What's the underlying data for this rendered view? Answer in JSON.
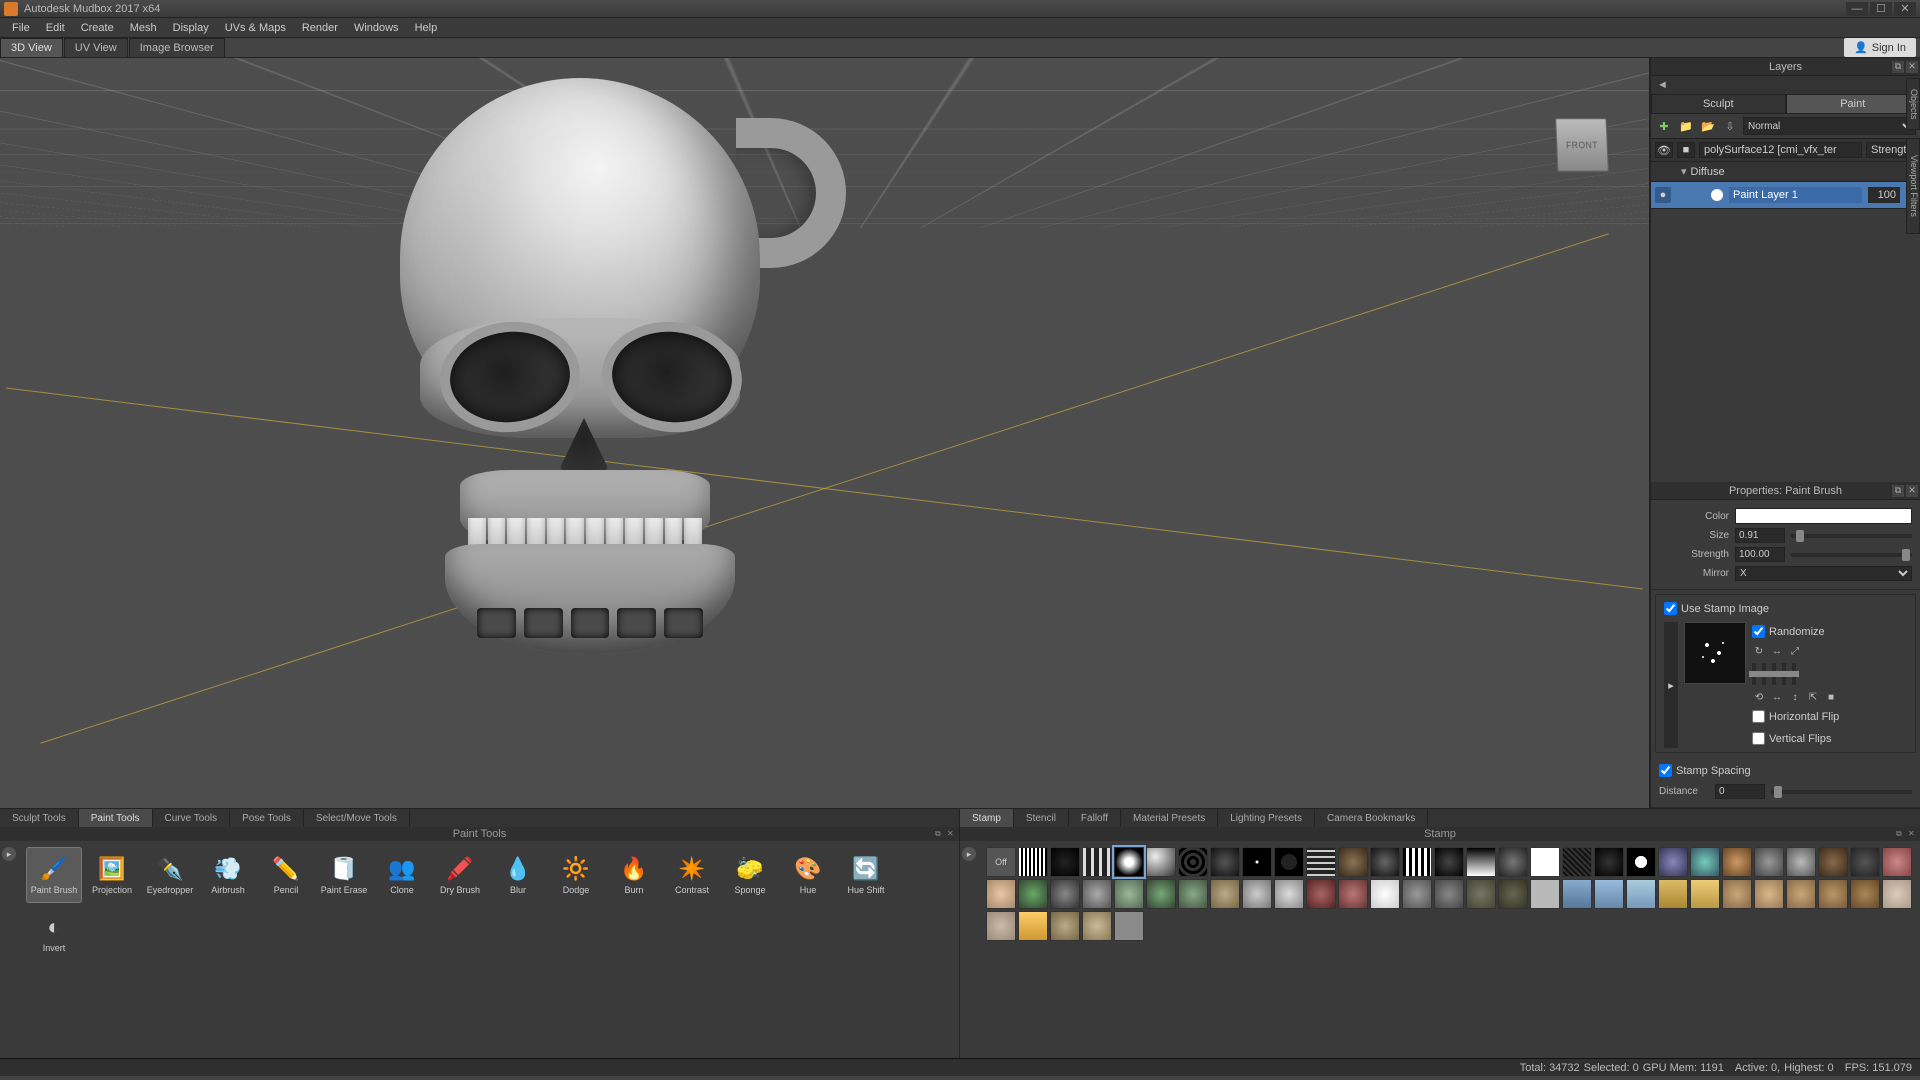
{
  "app": {
    "title": "Autodesk Mudbox 2017 x64"
  },
  "window": {
    "min": "—",
    "max": "☐",
    "close": "✕"
  },
  "menu": [
    "File",
    "Edit",
    "Create",
    "Mesh",
    "Display",
    "UVs & Maps",
    "Render",
    "Windows",
    "Help"
  ],
  "viewtabs": [
    "3D View",
    "UV View",
    "Image Browser"
  ],
  "signin": "Sign In",
  "viewcube": "FRONT",
  "side_tabs": {
    "objects": "Objects",
    "vpfilters": "Viewport Filters"
  },
  "layers": {
    "title": "Layers",
    "tabs": [
      "Sculpt",
      "Paint"
    ],
    "blend": "Normal",
    "object": "polySurface12 [cmi_vfx_ter",
    "strength_hdr": "Strength",
    "channel": "Diffuse",
    "layer": {
      "name": "Paint Layer 1",
      "opacity": "100"
    }
  },
  "props": {
    "title": "Properties: Paint Brush",
    "color": "Color",
    "size": {
      "label": "Size",
      "value": "0.91"
    },
    "strength": {
      "label": "Strength",
      "value": "100.00"
    },
    "mirror": {
      "label": "Mirror",
      "value": "X"
    },
    "use_stamp": "Use Stamp Image",
    "randomize": "Randomize",
    "hflip": "Horizontal Flip",
    "vflip": "Vertical Flips",
    "stamp_spacing": "Stamp Spacing",
    "distance": {
      "label": "Distance",
      "value": "0"
    }
  },
  "left_tray": {
    "tabs": [
      "Sculpt Tools",
      "Paint Tools",
      "Curve Tools",
      "Pose Tools",
      "Select/Move Tools"
    ],
    "title": "Paint Tools",
    "tools": [
      {
        "label": "Paint Brush",
        "icon": "🖌️",
        "active": true
      },
      {
        "label": "Projection",
        "icon": "🖼️"
      },
      {
        "label": "Eyedropper",
        "icon": "✒️"
      },
      {
        "label": "Airbrush",
        "icon": "💨"
      },
      {
        "label": "Pencil",
        "icon": "✏️"
      },
      {
        "label": "Paint Erase",
        "icon": "🧻"
      },
      {
        "label": "Clone",
        "icon": "👥"
      },
      {
        "label": "Dry Brush",
        "icon": "🖍️"
      },
      {
        "label": "Blur",
        "icon": "💧"
      },
      {
        "label": "Dodge",
        "icon": "🔆"
      },
      {
        "label": "Burn",
        "icon": "🔥"
      },
      {
        "label": "Contrast",
        "icon": "✴️"
      },
      {
        "label": "Sponge",
        "icon": "🧽"
      },
      {
        "label": "Hue",
        "icon": "🎨"
      },
      {
        "label": "Hue Shift",
        "icon": "🔄"
      },
      {
        "label": "Invert",
        "icon": "◐"
      }
    ]
  },
  "right_tray": {
    "tabs": [
      "Stamp",
      "Stencil",
      "Falloff",
      "Material Presets",
      "Lighting Presets",
      "Camera Bookmarks"
    ],
    "title": "Stamp",
    "off": "Off"
  },
  "status": {
    "total": "Total: 34732",
    "selected": "Selected: 0",
    "gpu": "GPU Mem: 1191",
    "active": "Active: 0,",
    "highest": "Highest: 0",
    "fps": "FPS: 151.079"
  }
}
